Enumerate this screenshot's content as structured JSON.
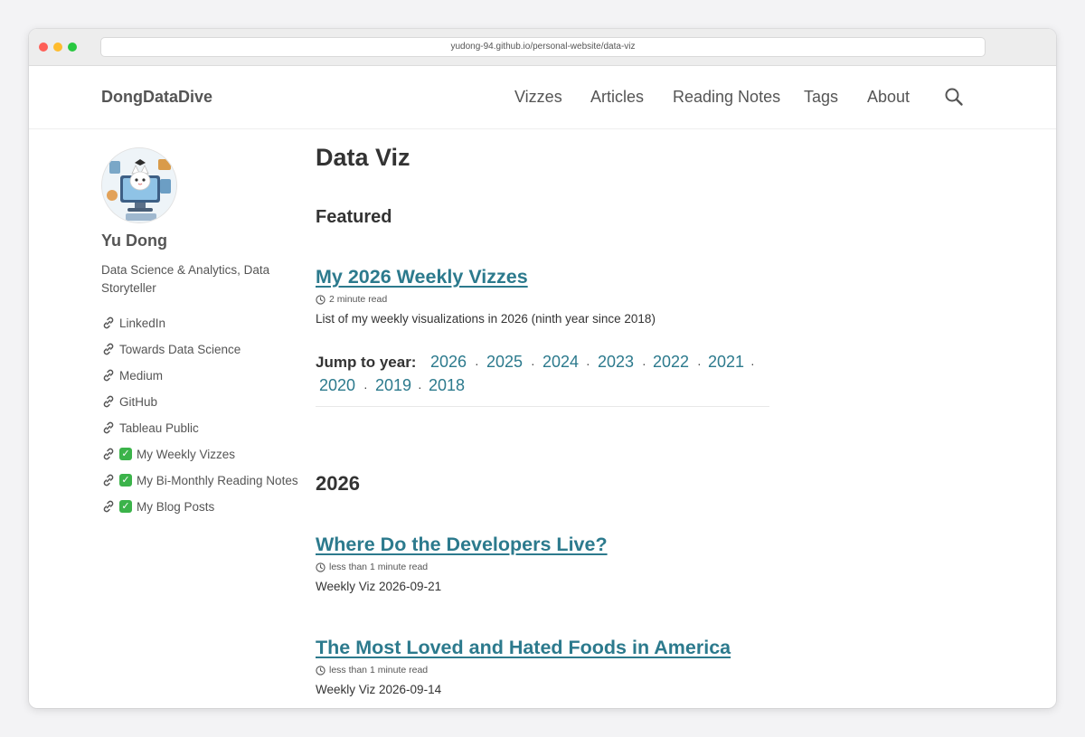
{
  "browser": {
    "url": "yudong-94.github.io/personal-website/data-viz"
  },
  "site": {
    "brand": "DongDataDive",
    "nav": [
      "Vizzes",
      "Articles",
      "Reading Notes",
      "Tags",
      "About"
    ]
  },
  "author": {
    "name": "Yu Dong",
    "bio": "Data Science & Analytics, Data Storyteller",
    "links": [
      {
        "label": "LinkedIn",
        "checked": false
      },
      {
        "label": "Towards Data Science",
        "checked": false
      },
      {
        "label": "Medium",
        "checked": false
      },
      {
        "label": "GitHub",
        "checked": false
      },
      {
        "label": "Tableau Public",
        "checked": false
      },
      {
        "label": "My Weekly Vizzes",
        "checked": true
      },
      {
        "label": "My Bi-Monthly Reading Notes",
        "checked": true
      },
      {
        "label": "My Blog Posts",
        "checked": true
      }
    ]
  },
  "page": {
    "title": "Data Viz",
    "featured_heading": "Featured",
    "featured": {
      "title": "My 2026 Weekly Vizzes",
      "read_time": "2 minute read",
      "excerpt": "List of my weekly visualizations in 2026 (ninth year since 2018)"
    },
    "jump_label": "Jump to year:",
    "years": [
      "2026",
      "2025",
      "2024",
      "2023",
      "2022",
      "2021",
      "2020",
      "2019",
      "2018"
    ],
    "separator": "·",
    "section_heading": "2026",
    "posts": [
      {
        "title": "Where Do the Developers Live?",
        "read_time": "less than 1 minute read",
        "excerpt": "Weekly Viz 2026-09-21"
      },
      {
        "title": "The Most Loved and Hated Foods in America",
        "read_time": "less than 1 minute read",
        "excerpt": "Weekly Viz 2026-09-14"
      }
    ]
  },
  "colors": {
    "link": "#2c7a8d",
    "text": "#333333",
    "muted": "#555555",
    "check": "#3bb34a"
  }
}
